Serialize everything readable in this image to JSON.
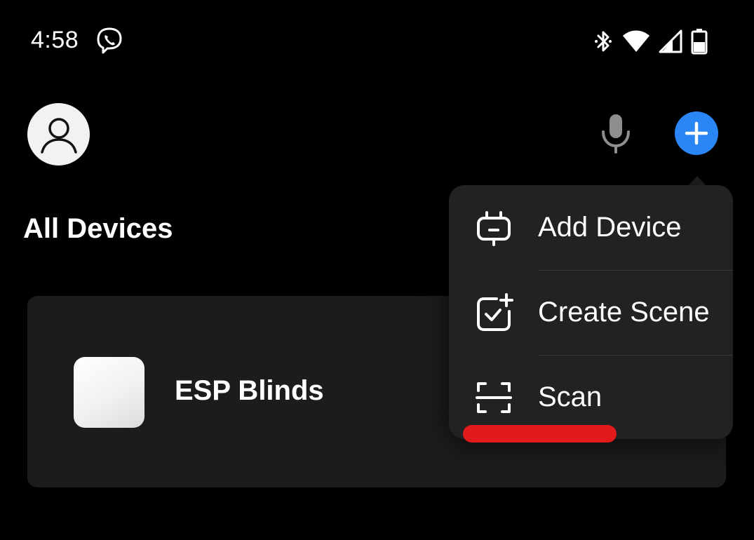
{
  "status_bar": {
    "time": "4:58"
  },
  "header": {
    "icons": [
      "user-avatar-icon",
      "microphone-icon",
      "plus-icon"
    ]
  },
  "page": {
    "title": "All Devices"
  },
  "devices": [
    {
      "name": "ESP Blinds"
    }
  ],
  "menu": {
    "items": [
      {
        "label": "Add Device",
        "icon": "add-device-icon"
      },
      {
        "label": "Create Scene",
        "icon": "create-scene-icon"
      },
      {
        "label": "Scan",
        "icon": "scan-icon"
      }
    ]
  },
  "colors": {
    "background": "#000000",
    "card": "#1c1c1c",
    "menu": "#222222",
    "accent": "#2a86f5",
    "highlight": "#e11b1b"
  }
}
